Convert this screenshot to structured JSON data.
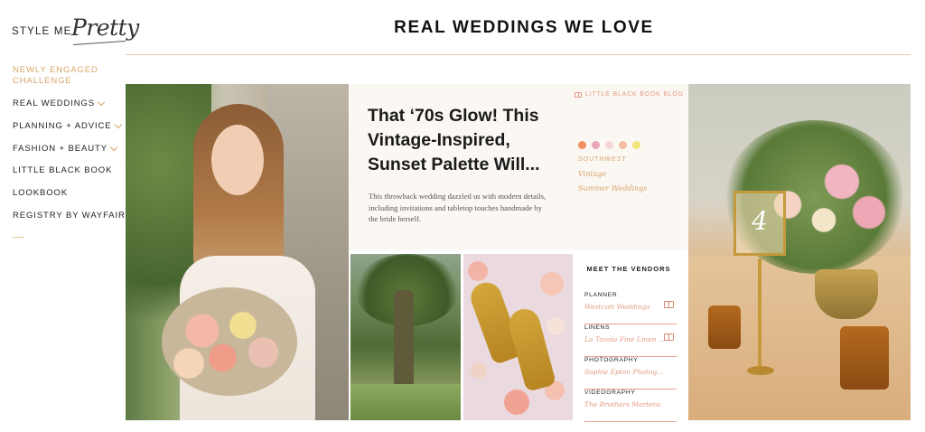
{
  "brand": {
    "wordmark": "STYLE ME",
    "script": "Pretty"
  },
  "nav": {
    "highlight": "NEWLY ENGAGED CHALLENGE",
    "items": [
      {
        "label": "REAL WEDDINGS",
        "has_dropdown": true
      },
      {
        "label": "PLANNING + ADVICE",
        "has_dropdown": true
      },
      {
        "label": "FASHION + BEAUTY",
        "has_dropdown": true
      },
      {
        "label": "LITTLE BLACK BOOK",
        "has_dropdown": false
      },
      {
        "label": "LOOKBOOK",
        "has_dropdown": false
      },
      {
        "label": "REGISTRY BY WAYFAIR",
        "has_dropdown": false
      }
    ]
  },
  "header": {
    "title": "REAL WEDDINGS WE LOVE"
  },
  "feature": {
    "blog_tag": "LITTLE BLACK BOOK BLOG",
    "title": "That ‘70s Glow! This Vintage-Inspired, Sunset Palette Will...",
    "description": "This throwback wedding dazzled us with modern details, including invitations and tabletop touches handmade by the bride herself.",
    "palette": [
      "#ef8f62",
      "#e8a6b8",
      "#f4d6d2",
      "#f4c0a0",
      "#f2e47a"
    ],
    "region": "SOUTHWEST",
    "tags": [
      "Vintage",
      "Summer Weddings"
    ]
  },
  "vendors": {
    "title": "MEET THE VENDORS",
    "items": [
      {
        "category": "PLANNER",
        "name": "Westcott Weddings",
        "has_book_icon": true
      },
      {
        "category": "LINENS",
        "name": "La Tavola Fine Linen ...",
        "has_book_icon": true
      },
      {
        "category": "PHOTOGRAPHY",
        "name": "Sophie Epton Photog...",
        "has_book_icon": false
      },
      {
        "category": "VIDEOGRAPHY",
        "name": "The Brothers Martens",
        "has_book_icon": false
      }
    ]
  },
  "table_number": "4",
  "colors": {
    "accent_gold": "#d9a56b",
    "accent_coral": "#e39a82",
    "rule": "#e2cbb0",
    "story_bg": "#fbf7f3"
  }
}
